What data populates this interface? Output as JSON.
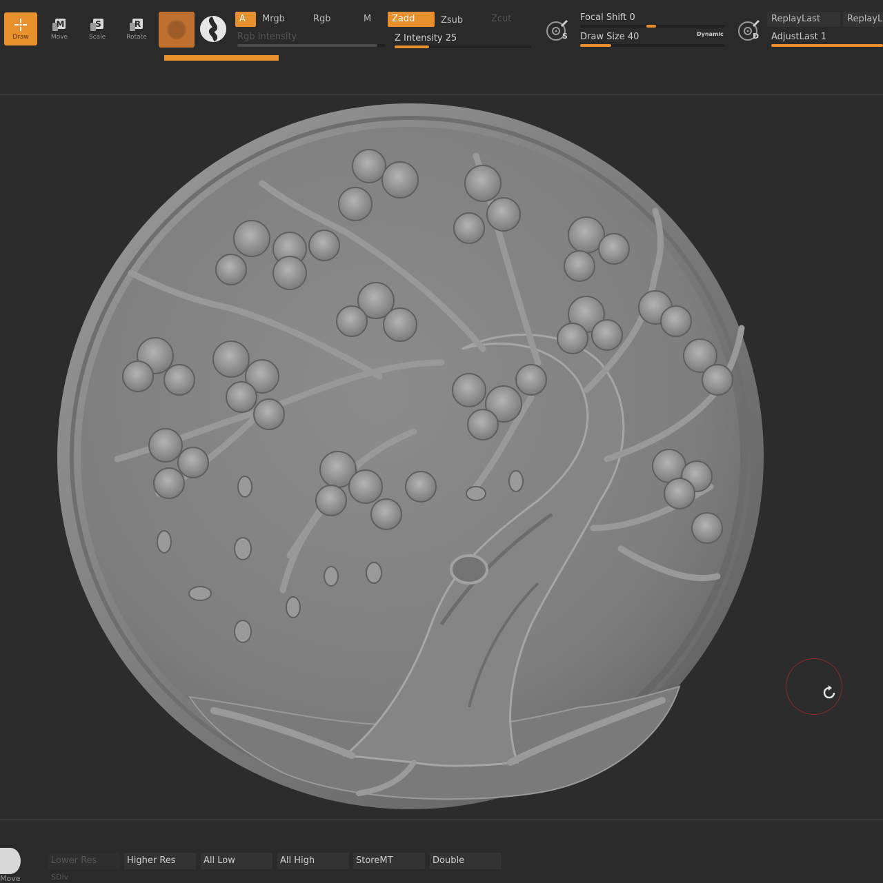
{
  "toolbar": {
    "tools": {
      "draw": "Draw",
      "move": "Move",
      "scale": "Scale",
      "rotate": "Rotate"
    },
    "tool_keys": {
      "move": "M",
      "scale": "S",
      "rotate": "R"
    },
    "modes": {
      "a": "A",
      "mrgb": "Mrgb",
      "rgb": "Rgb",
      "m": "M",
      "zadd": "Zadd",
      "zsub": "Zsub",
      "zcut": "Zcut"
    },
    "rgb_intensity": {
      "label": "Rgb Intensity",
      "value_fraction": 0.95
    },
    "z_intensity": {
      "label": "Z Intensity 25",
      "value": 25,
      "max": 100
    },
    "focal_shift": {
      "label": "Focal Shift 0",
      "value": 0
    },
    "draw_size": {
      "label": "Draw Size 40",
      "value": 40
    },
    "dynamic_label": "Dynamic",
    "s_key": "S",
    "d_key": "D",
    "replay_last": "ReplayLast",
    "replay_last_rel": "ReplayLastRel",
    "adjust_last": {
      "label": "AdjustLast 1",
      "value": 1
    }
  },
  "bottombar": {
    "buttons": {
      "lower_res": "Lower Res",
      "higher_res": "Higher Res",
      "all_low": "All Low",
      "all_high": "All High",
      "store_mt": "StoreMT",
      "double": "Double"
    },
    "sdiv_label": "SDiv",
    "move_caption": "Move"
  },
  "colors": {
    "accent": "#e8902e",
    "background": "#2c2c2c",
    "clay": "#8a8a8a",
    "cursor_ring": "#8a2a2a"
  },
  "icons": {
    "draw": "crosshair-icon",
    "move": "move-icon",
    "scale": "scale-icon",
    "rotate": "rotate-icon",
    "lazy_mouse": "target-brush-icon",
    "cursor": "refresh-icon"
  }
}
